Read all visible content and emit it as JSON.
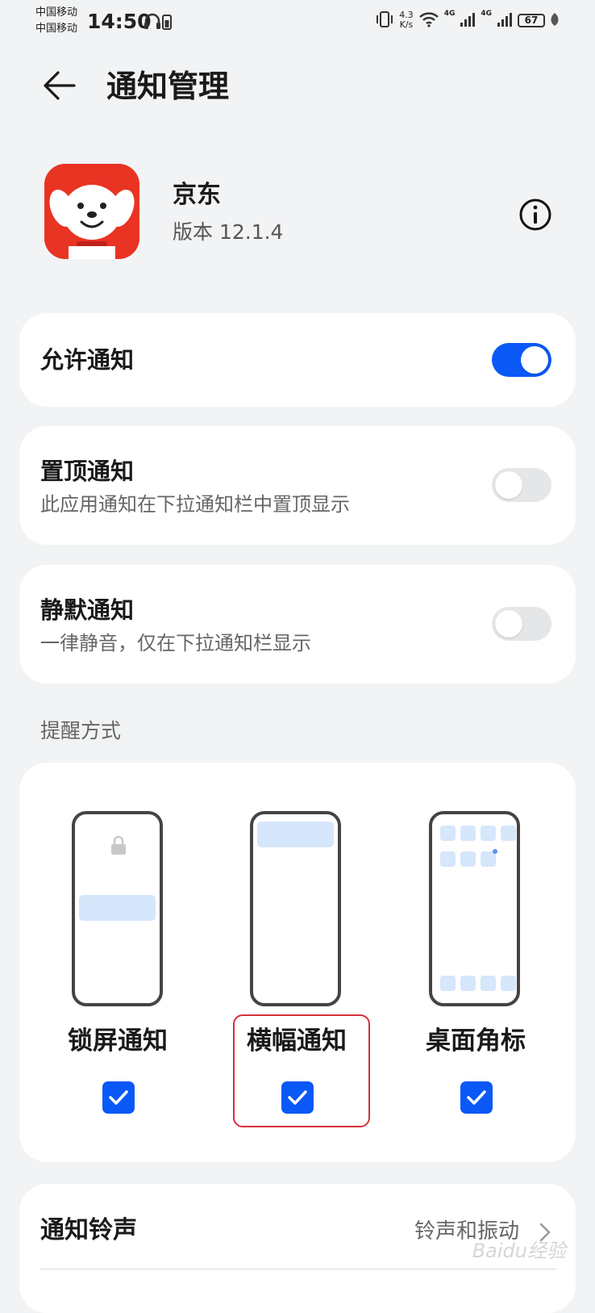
{
  "status_bar": {
    "carrier1": "中国移动",
    "carrier2": "中国移动",
    "time": "14:50",
    "speed_value": "4.3",
    "speed_unit": "K/s",
    "network1": "4G",
    "network2": "4G",
    "battery": "67"
  },
  "header": {
    "title": "通知管理"
  },
  "app": {
    "name": "京东",
    "version": "版本 12.1.4",
    "icon_color": "#e93323"
  },
  "allow": {
    "title": "允许通知",
    "enabled": true
  },
  "pin": {
    "title": "置顶通知",
    "subtitle": "此应用通知在下拉通知栏中置顶显示",
    "enabled": false
  },
  "silent": {
    "title": "静默通知",
    "subtitle": "一律静音，仅在下拉通知栏显示",
    "enabled": false
  },
  "reminder": {
    "section_label": "提醒方式",
    "options": [
      {
        "label": "锁屏通知",
        "checked": true
      },
      {
        "label": "横幅通知",
        "checked": true
      },
      {
        "label": "桌面角标",
        "checked": true
      }
    ]
  },
  "ringtone": {
    "title": "通知铃声",
    "value": "铃声和振动"
  },
  "watermark": "Baidu经验",
  "colors": {
    "accent": "#0a59f7",
    "highlight": "#d6303a",
    "background": "#f1f3f5"
  }
}
